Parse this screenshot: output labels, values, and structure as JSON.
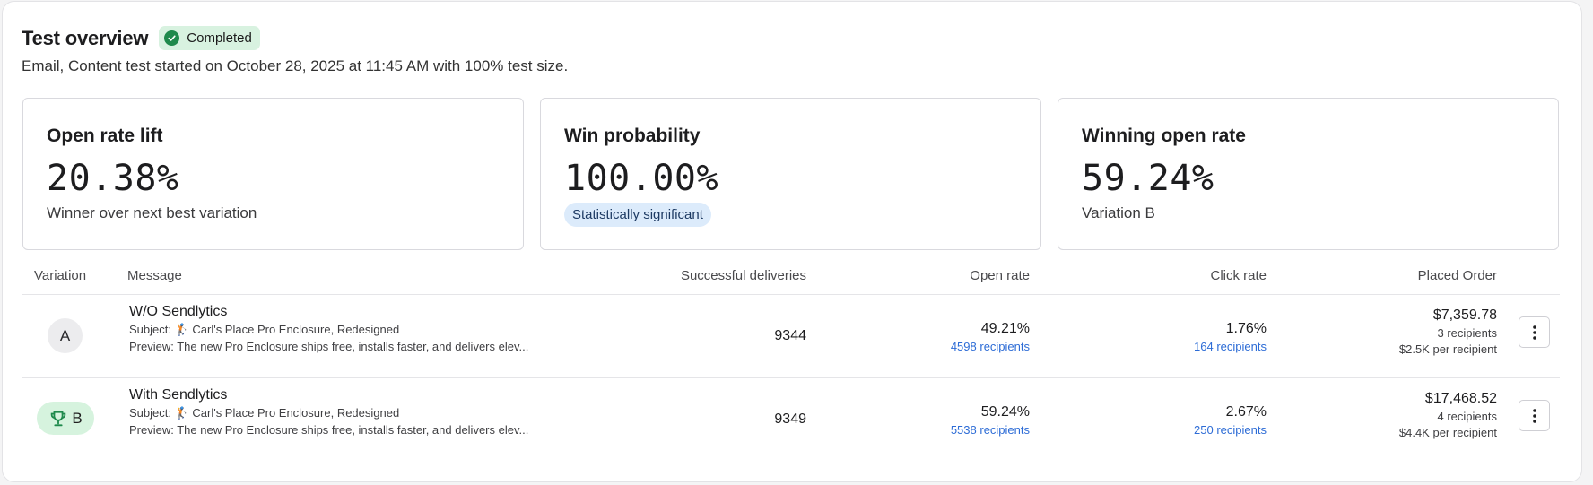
{
  "header": {
    "title": "Test overview",
    "status": "Completed",
    "subtitle": "Email, Content test started on October 28, 2025 at 11:45 AM with 100% test size."
  },
  "cards": [
    {
      "title": "Open rate lift",
      "value": "20.38%",
      "sub": "Winner over next best variation"
    },
    {
      "title": "Win probability",
      "value": "100.00%",
      "badge": "Statistically significant"
    },
    {
      "title": "Winning open rate",
      "value": "59.24%",
      "sub": "Variation B"
    }
  ],
  "table": {
    "columns": {
      "variation": "Variation",
      "message": "Message",
      "deliveries": "Successful deliveries",
      "open_rate": "Open rate",
      "click_rate": "Click rate",
      "placed_order": "Placed Order"
    },
    "rows": [
      {
        "variation": "A",
        "name": "W/O Sendlytics",
        "subject": "Subject: 🏌 Carl's Place Pro Enclosure, Redesigned",
        "preview": "Preview: The new Pro Enclosure ships free, installs faster, and delivers elev...",
        "deliveries": "9344",
        "open_rate": "49.21%",
        "open_recipients": "4598 recipients",
        "click_rate": "1.76%",
        "click_recipients": "164 recipients",
        "order_value": "$7,359.78",
        "order_recipients": "3 recipients",
        "order_per": "$2.5K per recipient"
      },
      {
        "variation": "B",
        "winner": true,
        "name": "With Sendlytics",
        "subject": "Subject: 🏌 Carl's Place Pro Enclosure, Redesigned",
        "preview": "Preview: The new Pro Enclosure ships free, installs faster, and delivers elev...",
        "deliveries": "9349",
        "open_rate": "59.24%",
        "open_recipients": "5538 recipients",
        "click_rate": "2.67%",
        "click_recipients": "250 recipients",
        "order_value": "$17,468.52",
        "order_recipients": "4 recipients",
        "order_per": "$4.4K per recipient"
      }
    ]
  },
  "icons": {
    "status": "check-circle-icon",
    "winner": "trophy-icon",
    "menu": "kebab-menu-icon"
  },
  "colors": {
    "success_green": "#1f8a4c",
    "link_blue": "#2d6cd6",
    "winner_bg": "#d6f3de",
    "significant_bg": "#dcebfb"
  }
}
